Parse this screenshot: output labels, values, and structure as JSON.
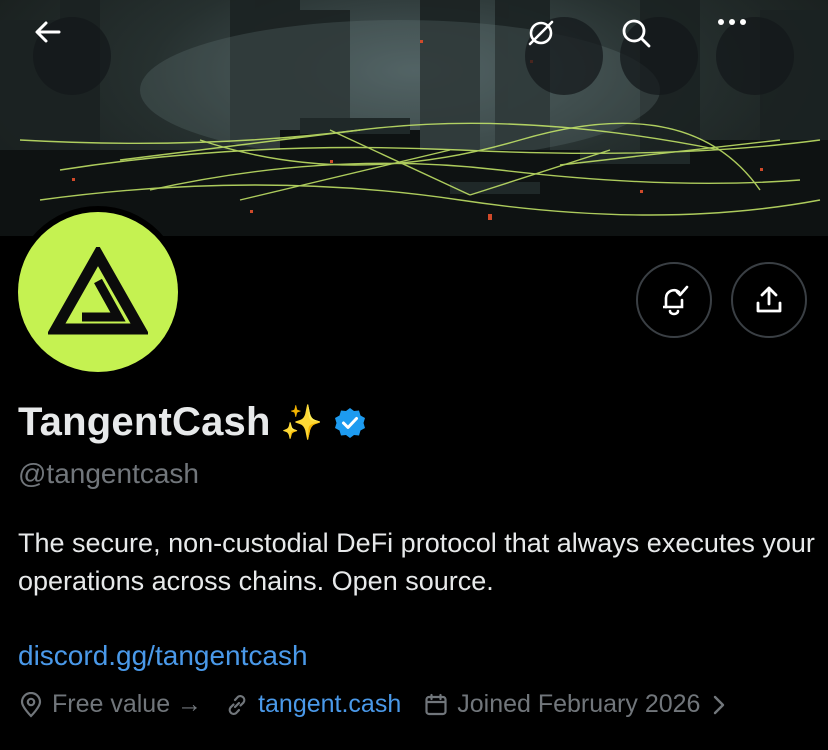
{
  "header": {
    "back_icon": "arrow-left-icon",
    "actions": [
      "grok-icon",
      "search-icon",
      "more-icon"
    ]
  },
  "profile": {
    "display_name": "TangentCash",
    "emoji": "✨",
    "verified": true,
    "handle": "@tangentcash",
    "bio": "The secure, non-custodial DeFi protocol that always executes your operations across chains. Open source.",
    "bio_link": "discord.gg/tangentcash",
    "avatar_color": "#c5f251",
    "accent_color": "#4a99e9"
  },
  "actions": {
    "notify_icon": "bell-check-icon",
    "share_icon": "share-icon"
  },
  "meta": {
    "location": "Free value →",
    "website": "tangent.cash",
    "joined": "Joined February 2026"
  }
}
